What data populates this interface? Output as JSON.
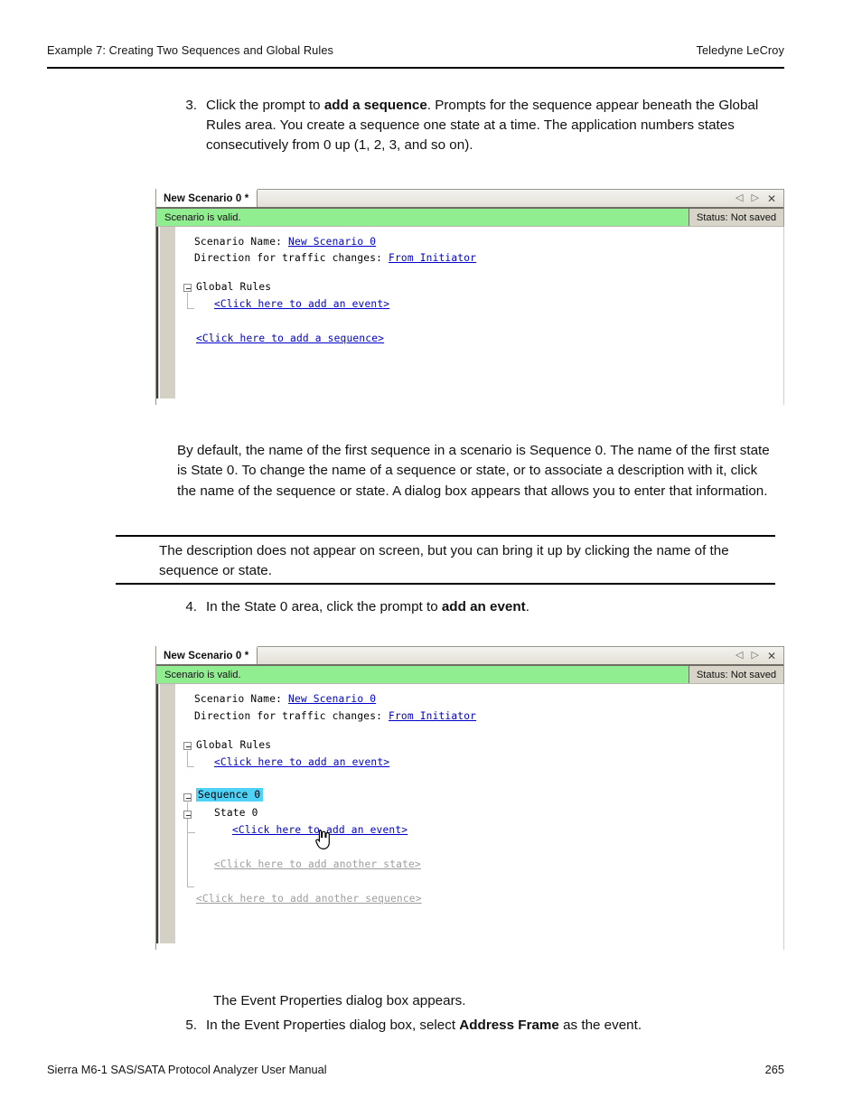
{
  "header": {
    "left": "Example 7: Creating Two Sequences and Global Rules",
    "right": "Teledyne LeCroy"
  },
  "footer": {
    "left": "Sierra M6-1 SAS/SATA Protocol Analyzer User Manual",
    "page": "265"
  },
  "steps": {
    "step3": {
      "number": "3.",
      "part1": "Click the prompt to ",
      "bold": "add a sequence",
      "part2": ". Prompts for the sequence appear beneath the Global Rules area. You create a sequence one state at a time. The application numbers states consecutively from 0 up (1, 2, 3, and so on)."
    },
    "step4": {
      "number": "4.",
      "part1": "In the State 0 area, click the prompt to ",
      "bold": "add an event",
      "part2": "."
    },
    "step5": {
      "number": "5.",
      "part1": "In the Event Properties dialog box, select ",
      "bold": "Address Frame",
      "part2": " as the event."
    }
  },
  "paragraphs": {
    "default_naming": "By default, the name of the first sequence in a scenario is Sequence 0. The name of the first state is State 0. To change the name of a sequence or state, or to associate a description with it, click the name of the sequence or state. A dialog box appears that allows you to enter that information.",
    "event_props_appears": "The Event Properties dialog box appears."
  },
  "note": {
    "text": "The description does not appear on screen, but you can bring it up by clicking the name of the sequence or state."
  },
  "screenshot1": {
    "tab_label": "New Scenario 0 *",
    "status_message": "Scenario is valid.",
    "status_saved": "Status: Not saved",
    "nav_prev_icon": "triangle-left-icon",
    "nav_next_icon": "triangle-right-icon",
    "close_icon": "close-icon",
    "lines": {
      "scenario_name_label": "Scenario Name:",
      "scenario_name_value": "New Scenario 0",
      "direction_label": "Direction for traffic changes:",
      "direction_value": "From Initiator",
      "global_rules": "Global Rules",
      "add_event_link": "<Click here to add an event>",
      "add_sequence_link": "<Click here to add a sequence>"
    }
  },
  "screenshot2": {
    "tab_label": "New Scenario 0 *",
    "status_message": "Scenario is valid.",
    "status_saved": "Status: Not saved",
    "nav_prev_icon": "triangle-left-icon",
    "nav_next_icon": "triangle-right-icon",
    "close_icon": "close-icon",
    "cursor_icon": "pointing-hand-cursor",
    "lines": {
      "scenario_name_label": "Scenario Name:",
      "scenario_name_value": "New Scenario 0",
      "direction_label": "Direction for traffic changes:",
      "direction_value": "From Initiator",
      "global_rules": "Global Rules",
      "add_event_link": "<Click here to add an event>",
      "sequence_0": "Sequence 0",
      "state_0": "State 0",
      "state_add_event_link": "<Click here to add an event>",
      "add_another_state_link": "<Click here to add another state>",
      "add_another_sequence_link": "<Click here to add another sequence>"
    }
  },
  "colors": {
    "valid_green": "#90ee90",
    "selection_cyan": "#4fd2f7",
    "link_blue": "#0000cc",
    "disabled_gray": "#9d9d9d",
    "chrome_gray": "#d4d0c6"
  }
}
